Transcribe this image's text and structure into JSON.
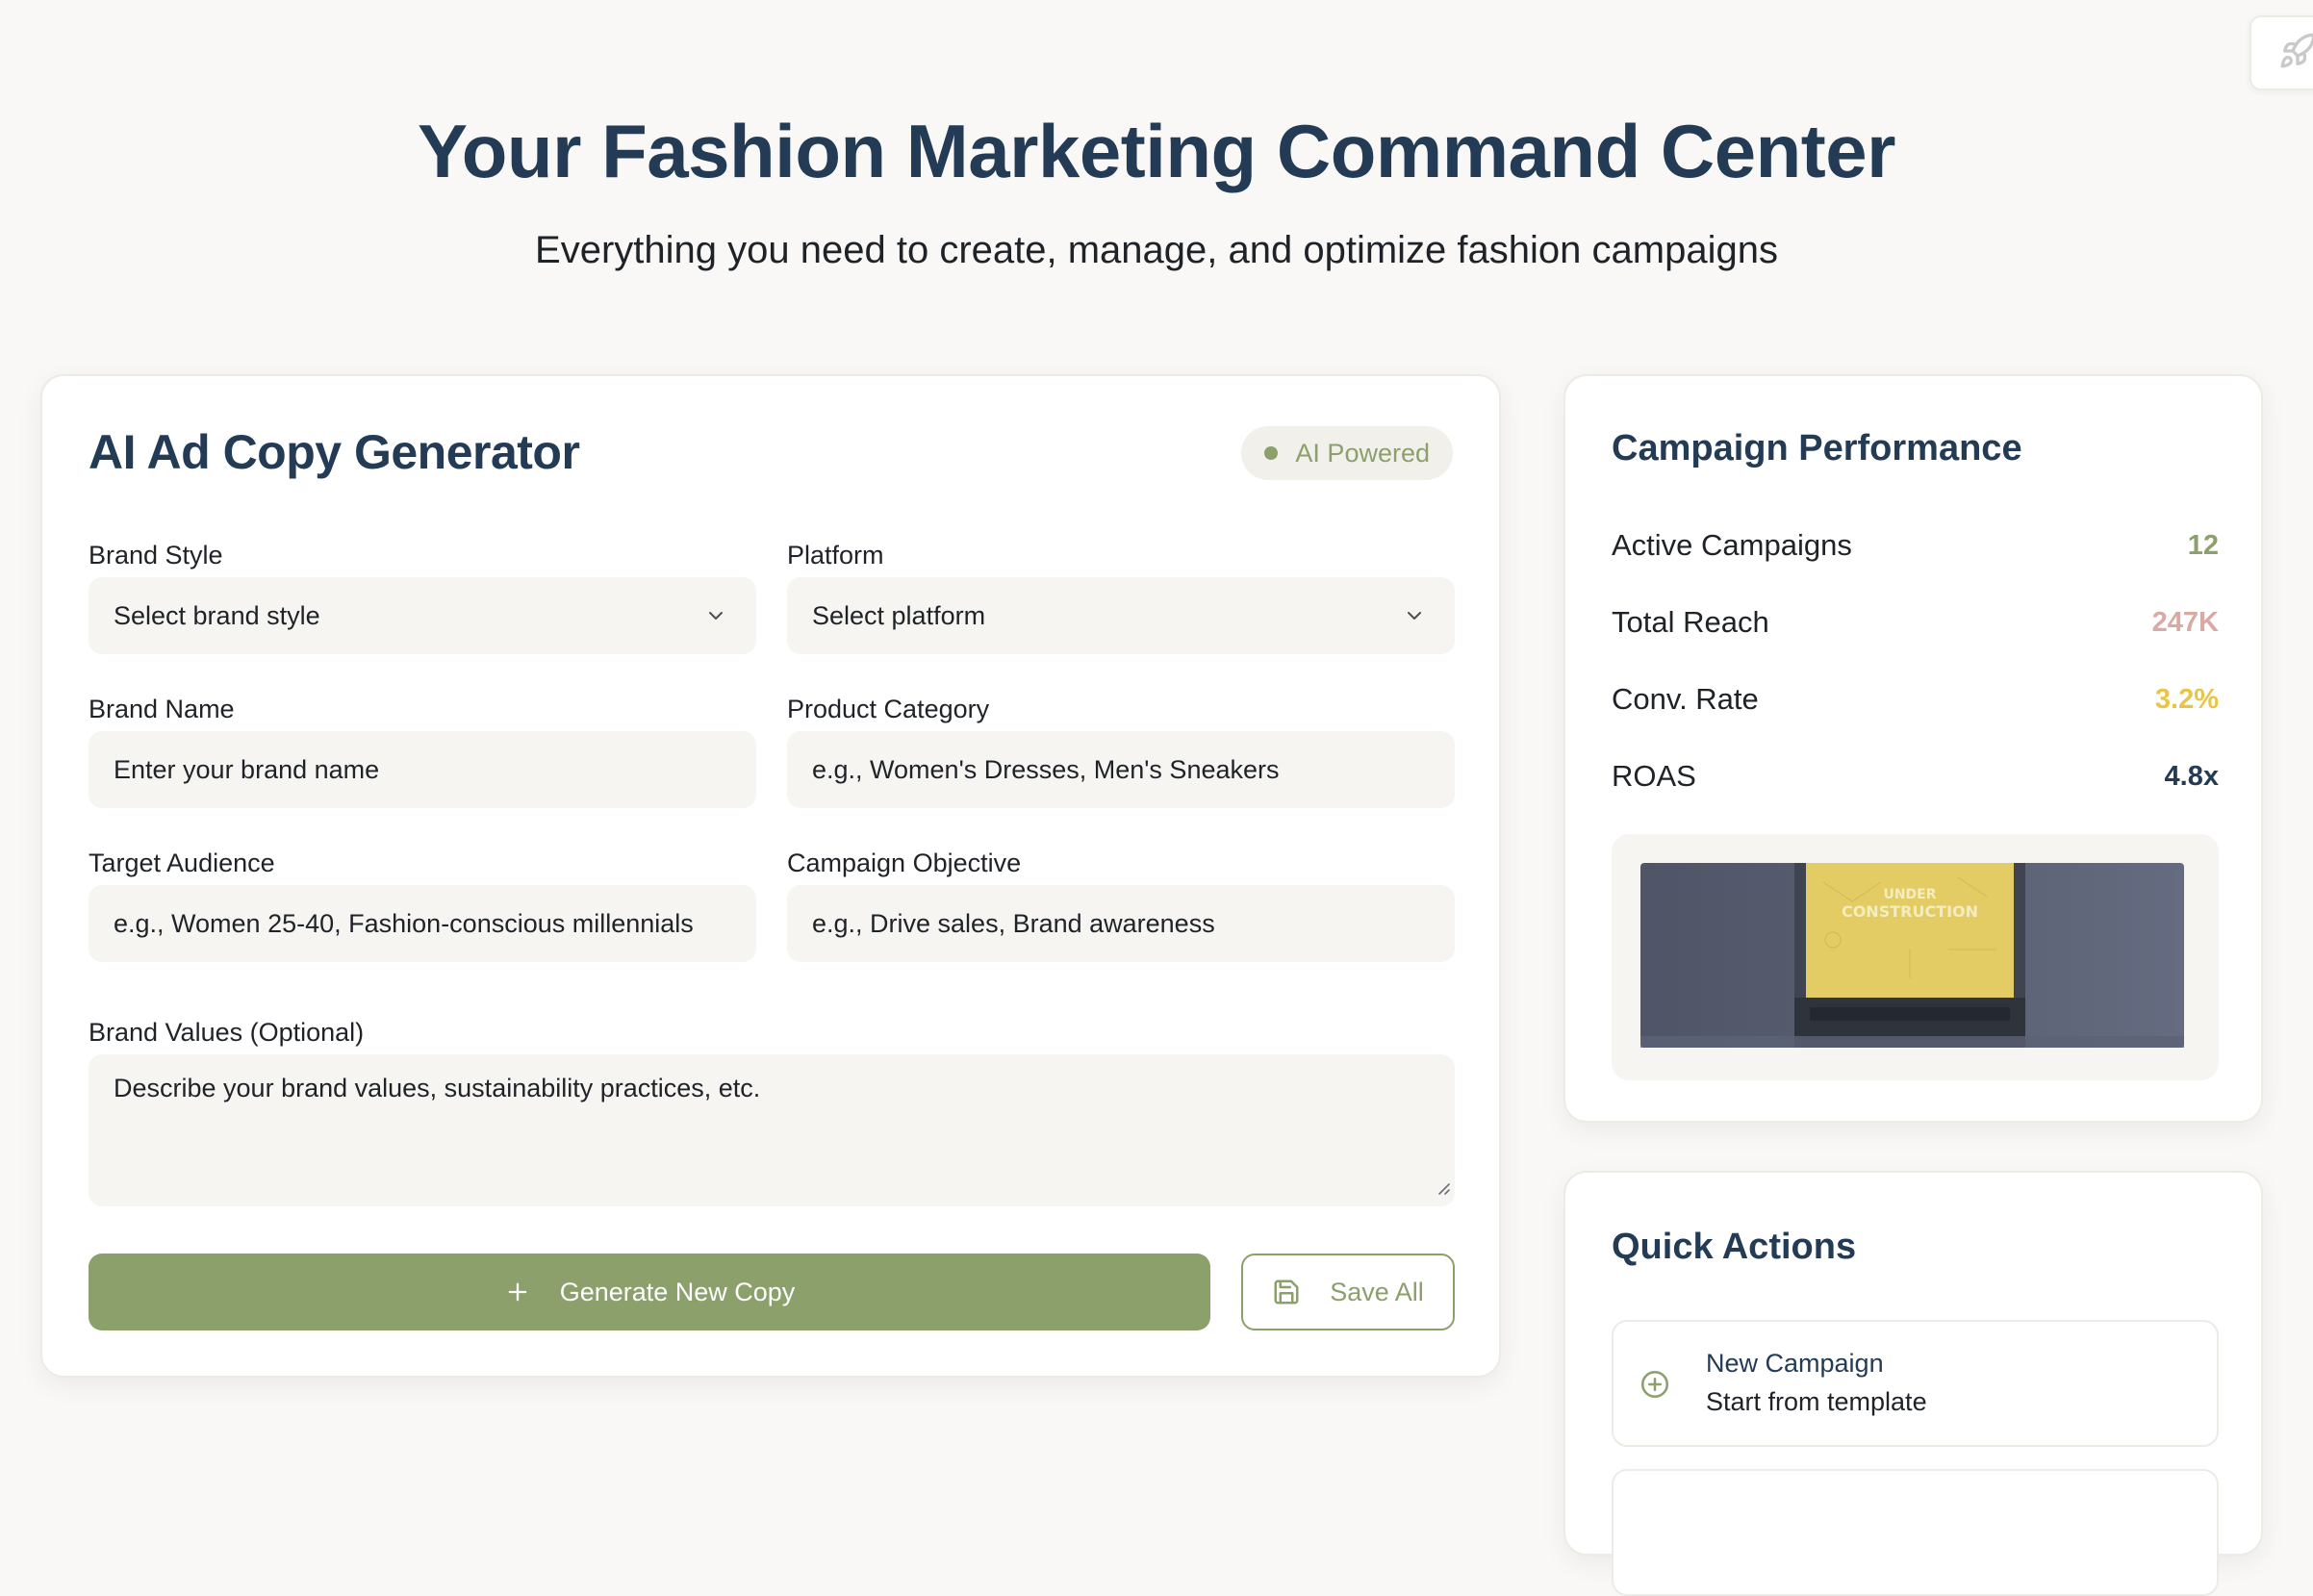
{
  "header": {
    "title": "Your Fashion Marketing Command Center",
    "subtitle": "Everything you need to create, manage, and optimize fashion campaigns"
  },
  "generator": {
    "title": "AI Ad Copy Generator",
    "badge": "AI Powered",
    "fields": {
      "brand_style": {
        "label": "Brand Style",
        "value": "Select brand style"
      },
      "platform": {
        "label": "Platform",
        "value": "Select platform"
      },
      "brand_name": {
        "label": "Brand Name",
        "placeholder": "Enter your brand name"
      },
      "product_category": {
        "label": "Product Category",
        "placeholder": "e.g., Women's Dresses, Men's Sneakers"
      },
      "target_audience": {
        "label": "Target Audience",
        "placeholder": "e.g., Women 25-40, Fashion-conscious millennials"
      },
      "campaign_objective": {
        "label": "Campaign Objective",
        "placeholder": "e.g., Drive sales, Brand awareness"
      },
      "brand_values": {
        "label": "Brand Values (Optional)",
        "placeholder": "Describe your brand values, sustainability practices, etc."
      }
    },
    "generate_label": "Generate New Copy",
    "save_label": "Save All"
  },
  "performance": {
    "title": "Campaign Performance",
    "stats": [
      {
        "label": "Active Campaigns",
        "value": "12",
        "color": "#8ba06a"
      },
      {
        "label": "Total Reach",
        "value": "247K",
        "color": "#d9aaa3"
      },
      {
        "label": "Conv. Rate",
        "value": "3.2%",
        "color": "#e8c547"
      },
      {
        "label": "ROAS",
        "value": "4.8x",
        "color": "#243b55"
      }
    ],
    "image_text": [
      "UNDER",
      "CONSTRUCTION"
    ]
  },
  "quick_actions": {
    "title": "Quick Actions",
    "items": [
      {
        "name": "New Campaign",
        "desc": "Start from template",
        "icon": "plus-circle-icon"
      }
    ]
  },
  "colors": {
    "accent": "#8ba06a",
    "heading": "#243b55",
    "background": "#f9f8f6"
  }
}
